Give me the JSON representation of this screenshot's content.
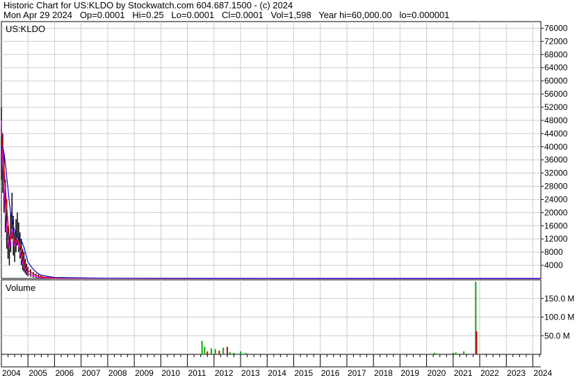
{
  "header": {
    "line1": "Historic Chart for US:KLDO by Stockwatch.com 604.687.1500 - (c) 2024",
    "line2": "Mon Apr 29 2024   Op=0.0001   Hi=0.25   Lo=0.0001   Cl=0.0001   Vol=1,598   Year hi=60,000.00   lo=0.000001"
  },
  "chart_data": [
    {
      "type": "line",
      "title": "US:KLDO",
      "ylim": [
        0,
        78000
      ],
      "y_ticks": [
        4000,
        8000,
        12000,
        16000,
        20000,
        24000,
        28000,
        32000,
        36000,
        40000,
        44000,
        48000,
        52000,
        56000,
        60000,
        64000,
        68000,
        72000,
        76000
      ],
      "x_ticks": [
        "2004",
        "2005",
        "2006",
        "2007",
        "2008",
        "2009",
        "2010",
        "2011",
        "2012",
        "2013",
        "2014",
        "2015",
        "2016",
        "2017",
        "2018",
        "2019",
        "2020",
        "2021",
        "2022",
        "2023",
        "2024"
      ],
      "x": [
        2004.0,
        2004.05,
        2004.1,
        2004.15,
        2004.2,
        2004.25,
        2004.3,
        2004.35,
        2004.4,
        2004.45,
        2004.5,
        2004.55,
        2004.6,
        2004.65,
        2004.7,
        2004.75,
        2004.8,
        2004.85,
        2004.9,
        2004.95,
        2005.0,
        2005.1,
        2005.2,
        2005.3,
        2005.4,
        2005.5,
        2006.0,
        2008.0,
        2012.0,
        2016.0,
        2020.0,
        2024.3
      ],
      "price_high": [
        52000,
        44000,
        38000,
        30000,
        24000,
        16000,
        13000,
        20000,
        26000,
        19000,
        14000,
        18000,
        20000,
        17000,
        14000,
        12000,
        9000,
        8000,
        6000,
        4500,
        3500,
        2800,
        2000,
        1500,
        1200,
        900,
        300,
        100,
        50,
        10,
        5,
        0.25
      ],
      "price_low": [
        30000,
        26000,
        20000,
        14000,
        9000,
        6000,
        4000,
        8000,
        12000,
        7000,
        5000,
        8000,
        10000,
        8000,
        6000,
        4000,
        2500,
        2000,
        1500,
        1000,
        700,
        500,
        300,
        200,
        100,
        50,
        20,
        5,
        1,
        0.5,
        0.1,
        0.0001
      ],
      "series": [
        {
          "name": "",
          "color": "#ff00ff",
          "values": [
            48000,
            36000,
            28000,
            20000,
            15000,
            11000,
            9000,
            12000,
            15000,
            12000,
            10000,
            11000,
            12000,
            10000,
            8000,
            6000,
            4500,
            3500,
            2800,
            2000,
            1500,
            1100,
            800,
            500,
            350,
            250,
            80,
            20,
            5,
            1,
            0.5,
            0.0001
          ]
        },
        {
          "name": "",
          "color": "#ff0000",
          "values": [
            44000,
            40000,
            34000,
            28000,
            22000,
            17000,
            13000,
            12000,
            13000,
            12500,
            11500,
            11000,
            11500,
            11000,
            10000,
            8500,
            7000,
            5500,
            4300,
            3300,
            2500,
            1900,
            1400,
            1000,
            700,
            500,
            150,
            30,
            8,
            2,
            1,
            0.0001
          ]
        },
        {
          "name": "",
          "color": "#0000cc",
          "values": [
            40000,
            40000,
            38000,
            35000,
            31000,
            27000,
            23000,
            20000,
            18000,
            16000,
            14500,
            13500,
            13000,
            12500,
            12000,
            11500,
            10500,
            9500,
            8000,
            6500,
            5000,
            3800,
            2800,
            2000,
            1400,
            1000,
            300,
            60,
            15,
            4,
            2,
            0.0001
          ]
        }
      ]
    },
    {
      "type": "bar",
      "title": "Volume",
      "ylim": [
        0,
        200
      ],
      "y_ticks": [
        50,
        100,
        150
      ],
      "y_tick_labels": [
        "50.0 M",
        "100.0 M",
        "150.0 M"
      ],
      "bars": [
        {
          "x": 2011.55,
          "v": 36,
          "color": "#00aa00"
        },
        {
          "x": 2011.65,
          "v": 20,
          "color": "#00aa00"
        },
        {
          "x": 2011.75,
          "v": 8,
          "color": "#cc0000"
        },
        {
          "x": 2011.9,
          "v": 16,
          "color": "#00aa00"
        },
        {
          "x": 2012.05,
          "v": 14,
          "color": "#00aa00"
        },
        {
          "x": 2012.2,
          "v": 10,
          "color": "#cc0000"
        },
        {
          "x": 2012.35,
          "v": 18,
          "color": "#00aa00"
        },
        {
          "x": 2012.5,
          "v": 20,
          "color": "#cc0000"
        },
        {
          "x": 2012.6,
          "v": 6,
          "color": "#00aa00"
        },
        {
          "x": 2012.75,
          "v": 4,
          "color": "#00aa00"
        },
        {
          "x": 2013.0,
          "v": 8,
          "color": "#00aa00"
        },
        {
          "x": 2013.2,
          "v": 4,
          "color": "#00aa00"
        },
        {
          "x": 2020.3,
          "v": 4,
          "color": "#00aa00"
        },
        {
          "x": 2021.0,
          "v": 4,
          "color": "#00aa00"
        },
        {
          "x": 2021.1,
          "v": 5,
          "color": "#00aa00"
        },
        {
          "x": 2021.4,
          "v": 8,
          "color": "#00aa00"
        },
        {
          "x": 2021.85,
          "v": 195,
          "color": "#00aa00"
        },
        {
          "x": 2021.88,
          "v": 62,
          "color": "#cc0000"
        },
        {
          "x": 2022.2,
          "v": 2,
          "color": "#00aa00"
        }
      ]
    }
  ]
}
